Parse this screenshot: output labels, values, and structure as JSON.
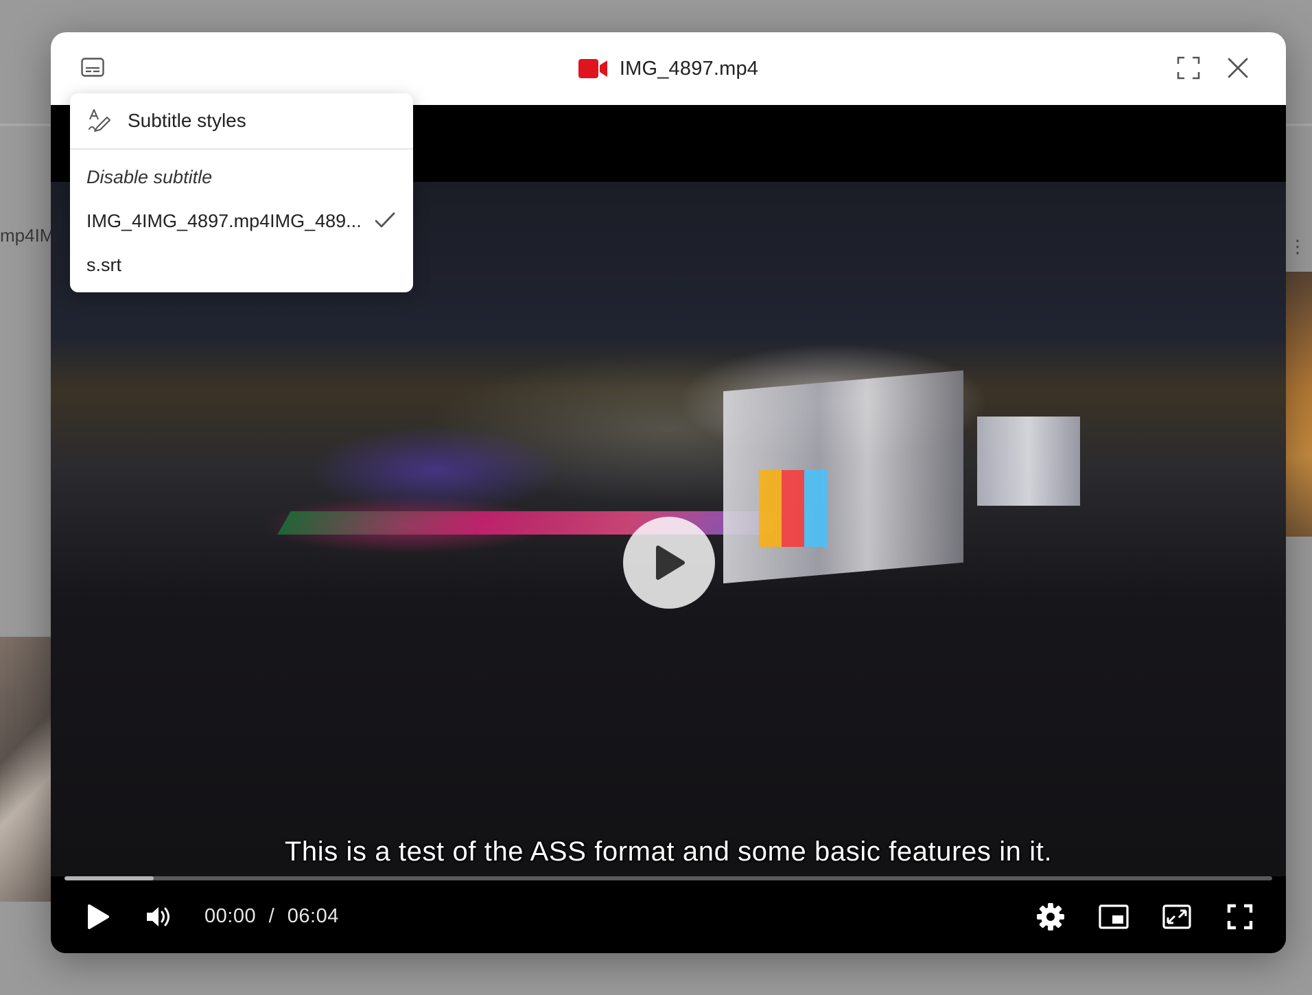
{
  "background": {
    "partial_text": "mp4IM"
  },
  "window": {
    "title": "IMG_4897.mp4",
    "file_icon": "video-camera-icon",
    "accent_color": "#e0141e",
    "subtitle_button_icon": "subtitles-icon",
    "fullscreen_icon": "expand-icon",
    "close_icon": "close-icon"
  },
  "subtitle_menu": {
    "styles_label": "Subtitle styles",
    "styles_icon": "font-style-icon",
    "items": [
      {
        "label": "Disable subtitle",
        "selected": false
      },
      {
        "label": "IMG_4IMG_4897.mp4IMG_489...",
        "selected": true
      },
      {
        "label": "s.srt",
        "selected": false
      }
    ]
  },
  "player": {
    "caption": "This is a test of the ASS format and some basic features in it.",
    "current_time": "00:00",
    "separator": "/",
    "duration": "06:04",
    "buffered_fraction": 0.074,
    "big_play_icon": "play-icon",
    "controls": {
      "play_icon": "play-icon",
      "volume_icon": "volume-icon",
      "settings_icon": "gear-icon",
      "miniplayer_icon": "miniplayer-icon",
      "pip_icon": "picture-in-picture-icon",
      "fullscreen_icon": "fullscreen-icon"
    }
  }
}
